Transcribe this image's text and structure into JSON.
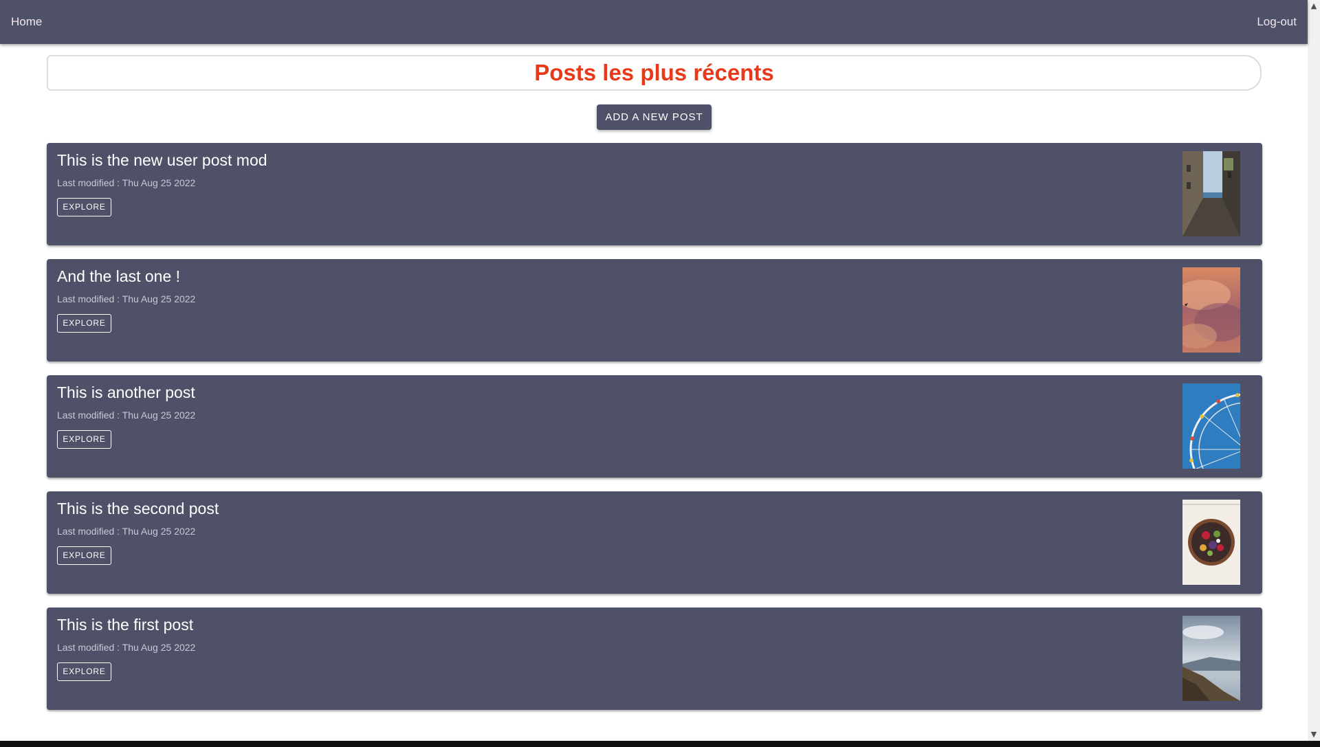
{
  "nav": {
    "home_label": "Home",
    "logout_label": "Log-out"
  },
  "header": {
    "title": "Posts les plus récents"
  },
  "actions": {
    "add_post_label": "ADD A NEW POST"
  },
  "posts": [
    {
      "title": "This is the new user post mod",
      "modified": "Last modified : Thu Aug 25 2022",
      "explore_label": "EXPLORE",
      "image": "alley-photo"
    },
    {
      "title": "And the last one !",
      "modified": "Last modified : Thu Aug 25 2022",
      "explore_label": "EXPLORE",
      "image": "sunset-clouds-photo"
    },
    {
      "title": "This is another post",
      "modified": "Last modified : Thu Aug 25 2022",
      "explore_label": "EXPLORE",
      "image": "ferris-wheel-photo"
    },
    {
      "title": "This is the second post",
      "modified": "Last modified : Thu Aug 25 2022",
      "explore_label": "EXPLORE",
      "image": "salad-bowl-photo"
    },
    {
      "title": "This is the first post",
      "modified": "Last modified : Thu Aug 25 2022",
      "explore_label": "EXPLORE",
      "image": "mountain-lake-photo"
    }
  ],
  "colors": {
    "nav_bg": "#4f5168",
    "card_bg": "#4f5168",
    "title_accent": "#e8391a"
  }
}
